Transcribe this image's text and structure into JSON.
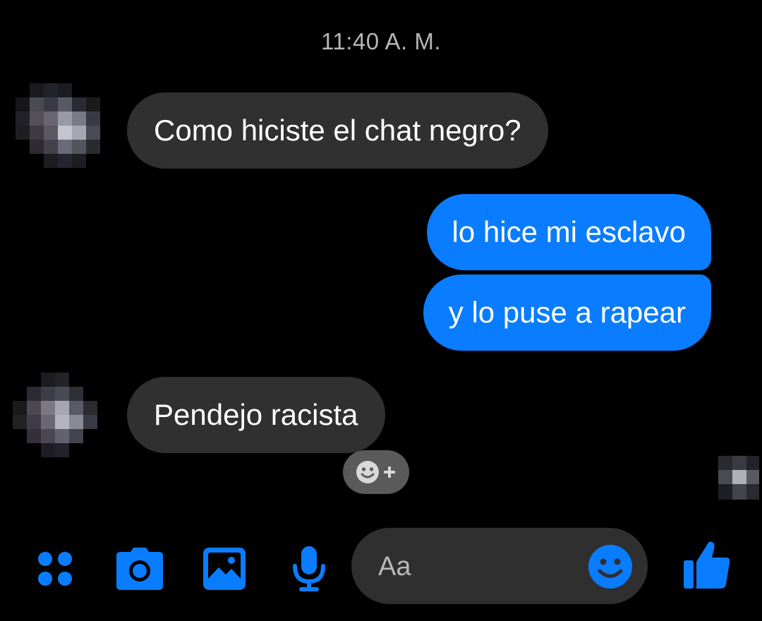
{
  "timestamp": "11:40 A. M.",
  "messages": [
    {
      "direction": "incoming",
      "text": "Como hiciste el chat negro?"
    },
    {
      "direction": "outgoing",
      "text": "lo hice mi esclavo"
    },
    {
      "direction": "outgoing",
      "text": "y lo puse a rapear"
    },
    {
      "direction": "incoming",
      "text": "Pendejo racista"
    }
  ],
  "reaction_button": {
    "icon": "add-reaction-icon"
  },
  "composer": {
    "placeholder": "Aa",
    "icons": [
      "apps-icon",
      "camera-icon",
      "gallery-icon",
      "microphone-icon",
      "emoji-icon",
      "thumbs-up-icon"
    ]
  },
  "colors": {
    "background": "#000000",
    "accent": "#0a7cff",
    "incoming_bubble": "#303030",
    "composer_bg": "#2f2f2f",
    "timestamp": "#b6b6b6"
  }
}
